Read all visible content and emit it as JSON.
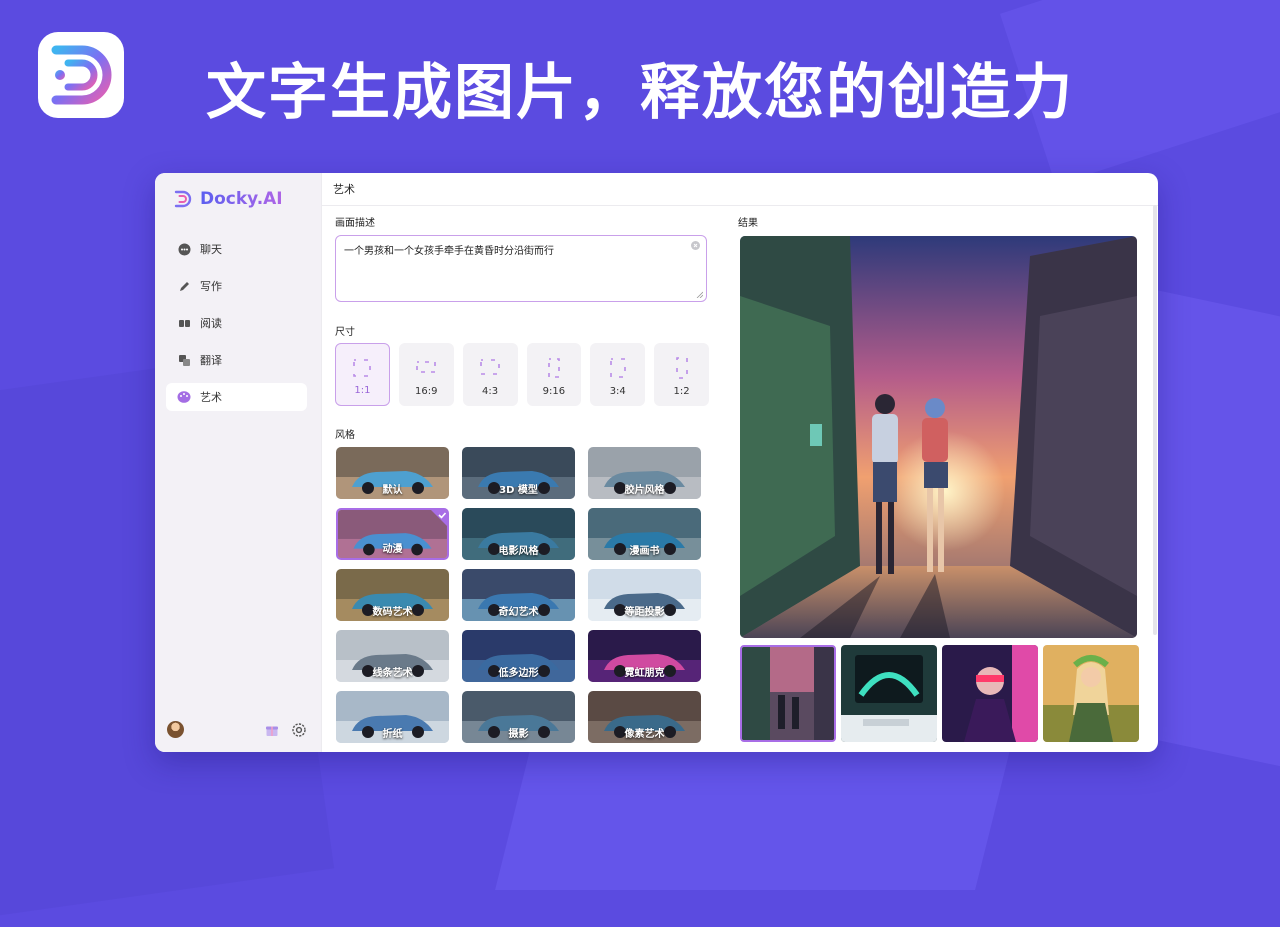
{
  "headline": "文字生成图片，释放您的创造力",
  "brand": {
    "name": "Docky.AI"
  },
  "colors": {
    "background": "#5b4be0",
    "accent": "#a86de6",
    "brand_gradient": [
      "#5b5ff0",
      "#b065e6"
    ]
  },
  "nav": {
    "items": [
      {
        "label": "聊天",
        "icon": "chat-icon"
      },
      {
        "label": "写作",
        "icon": "pen-icon"
      },
      {
        "label": "阅读",
        "icon": "book-icon"
      },
      {
        "label": "翻译",
        "icon": "translate-icon"
      },
      {
        "label": "艺术",
        "icon": "palette-icon",
        "active": true
      }
    ]
  },
  "page": {
    "title": "艺术"
  },
  "prompt": {
    "label": "画面描述",
    "value": "一个男孩和一个女孩手牵手在黄昏时分沿街而行"
  },
  "size": {
    "label": "尺寸",
    "options": [
      "1:1",
      "16:9",
      "4:3",
      "9:16",
      "3:4",
      "1:2"
    ],
    "selected": "1:1"
  },
  "style": {
    "label": "风格",
    "options": [
      "默认",
      "3D 模型",
      "胶片风格",
      "动漫",
      "电影风格",
      "漫画书",
      "数码艺术",
      "奇幻艺术",
      "等距投影",
      "线条艺术",
      "低多边形",
      "霓虹朋克",
      "折纸",
      "摄影",
      "像素艺术"
    ],
    "selected": "动漫"
  },
  "result": {
    "label": "结果",
    "selected_index": 0,
    "thumbnail_count": 4
  }
}
